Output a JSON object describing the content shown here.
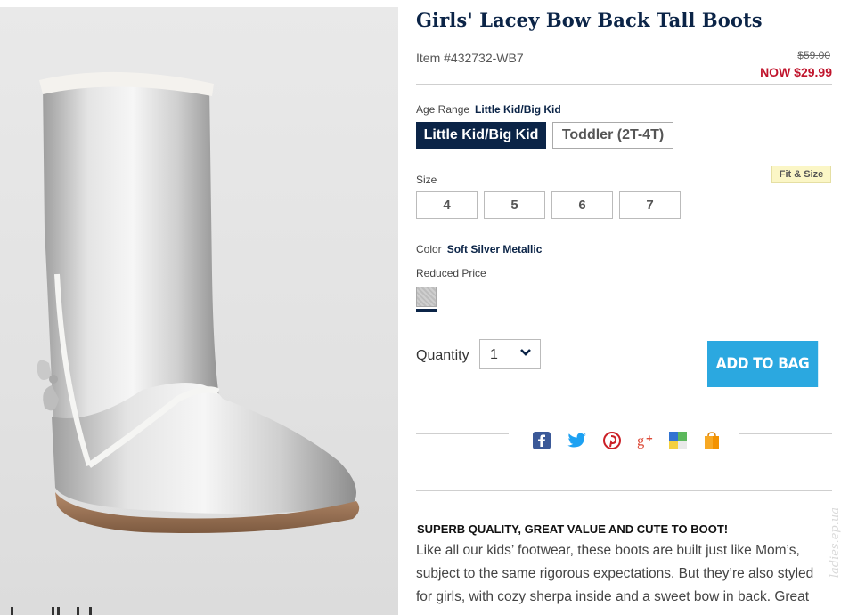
{
  "product": {
    "title": "Girls' Lacey Bow Back Tall Boots",
    "item_number": "Item #432732-WB7",
    "old_price": "$59.00",
    "now_price": "NOW $29.99"
  },
  "age_range": {
    "label": "Age Range",
    "selected": "Little Kid/Big Kid",
    "options": [
      "Little Kid/Big Kid",
      "Toddler (2T-4T)"
    ]
  },
  "size": {
    "label": "Size",
    "fit_link": "Fit & Size",
    "options": [
      "4",
      "5",
      "6",
      "7"
    ]
  },
  "color": {
    "label": "Color",
    "selected": "Soft Silver Metallic",
    "price_note": "Reduced Price"
  },
  "quantity": {
    "label": "Quantity",
    "value": "1"
  },
  "actions": {
    "add_to_bag": "ADD TO BAG"
  },
  "share": {
    "icons": [
      "facebook-icon",
      "twitter-icon",
      "pinterest-icon",
      "google-plus-icon",
      "delicious-icon",
      "shopping-bag-icon"
    ]
  },
  "description": {
    "heading": "SUPERB QUALITY, GREAT VALUE AND CUTE TO BOOT!",
    "lines": [
      "Like all our kids’ footwear, these boots are built just like Mom’s,",
      "subject to the same rigorous expectations. But they’re also styled",
      "for girls, with cozy sherpa inside and a sweet bow in back. Great"
    ]
  },
  "watermark": "ladies.ep.ua",
  "colors": {
    "navy": "#0b2447",
    "sale_red": "#c0142c",
    "button_blue": "#2ba8e0",
    "fit_bg": "#fbf6c6"
  }
}
